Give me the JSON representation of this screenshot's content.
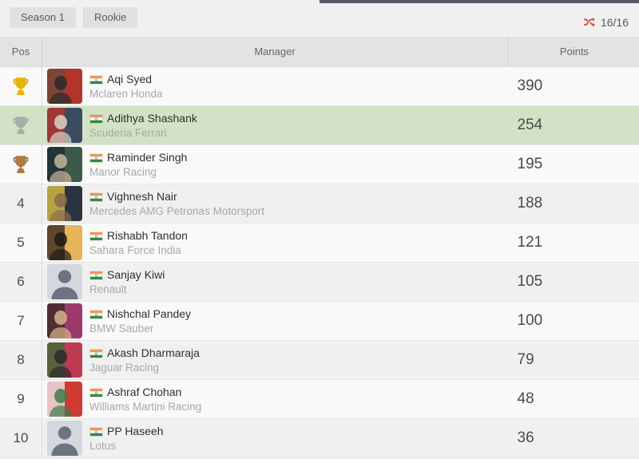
{
  "toolbar": {
    "tabs": [
      {
        "label": "Season 1"
      },
      {
        "label": "Rookie"
      }
    ],
    "shuffle_icon": "shuffle-icon",
    "shuffle_count": "16/16",
    "shuffle_color": "#d93025"
  },
  "table": {
    "headers": {
      "pos": "Pos",
      "manager": "Manager",
      "points": "Points"
    },
    "highlight_color": "#d2e2c6",
    "rows": [
      {
        "pos": "1",
        "medal": "gold-trophy-icon",
        "name": "Aqi Syed",
        "team": "Mclaren Honda",
        "points": "390",
        "flag": "india-flag-icon",
        "avatar": "photo",
        "highlight": false
      },
      {
        "pos": "2",
        "medal": "silver-trophy-icon",
        "name": "Adithya Shashank",
        "team": "Scuderia Ferrari",
        "points": "254",
        "flag": "india-flag-icon",
        "avatar": "photo",
        "highlight": true
      },
      {
        "pos": "3",
        "medal": "bronze-trophy-icon",
        "name": "Raminder Singh",
        "team": "Manor Racing",
        "points": "195",
        "flag": "india-flag-icon",
        "avatar": "photo",
        "highlight": false
      },
      {
        "pos": "4",
        "medal": "",
        "name": "Vighnesh Nair",
        "team": "Mercedes AMG Petronas Motorsport",
        "points": "188",
        "flag": "india-flag-icon",
        "avatar": "photo",
        "highlight": false
      },
      {
        "pos": "5",
        "medal": "",
        "name": "Rishabh Tandon",
        "team": "Sahara Force India",
        "points": "121",
        "flag": "india-flag-icon",
        "avatar": "photo",
        "highlight": false
      },
      {
        "pos": "6",
        "medal": "",
        "name": "Sanjay Kiwi",
        "team": "Renault",
        "points": "105",
        "flag": "india-flag-icon",
        "avatar": "default",
        "highlight": false
      },
      {
        "pos": "7",
        "medal": "",
        "name": "Nishchal Pandey",
        "team": "BMW Sauber",
        "points": "100",
        "flag": "india-flag-icon",
        "avatar": "photo",
        "highlight": false
      },
      {
        "pos": "8",
        "medal": "",
        "name": "Akash Dharmaraja",
        "team": "Jaguar Racing",
        "points": "79",
        "flag": "india-flag-icon",
        "avatar": "photo",
        "highlight": false
      },
      {
        "pos": "9",
        "medal": "",
        "name": "Ashraf Chohan",
        "team": "Williams Martini Racing",
        "points": "48",
        "flag": "india-flag-icon",
        "avatar": "photo",
        "highlight": false
      },
      {
        "pos": "10",
        "medal": "",
        "name": "PP Haseeh",
        "team": "Lotus",
        "points": "36",
        "flag": "india-flag-icon",
        "avatar": "default",
        "highlight": false
      }
    ]
  }
}
